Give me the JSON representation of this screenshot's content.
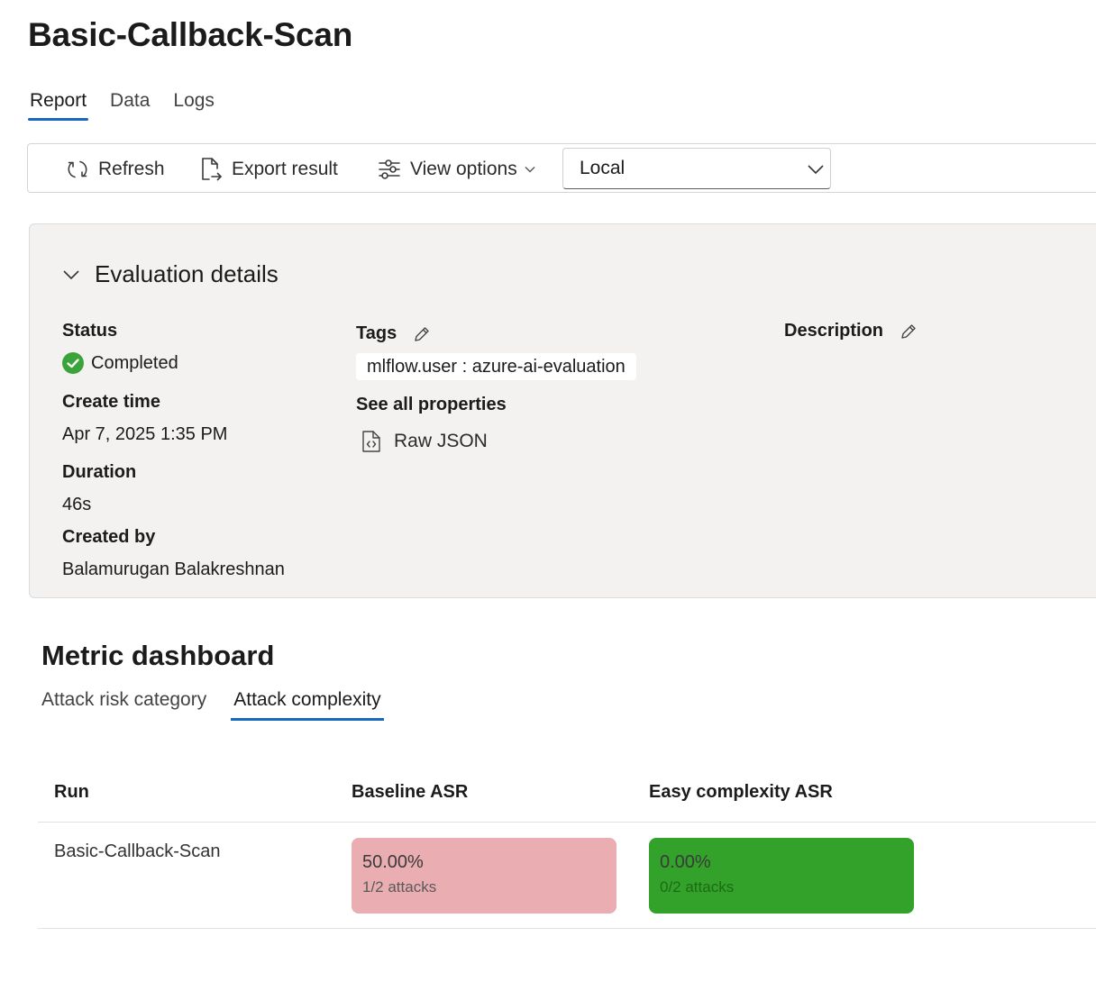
{
  "page": {
    "title": "Basic-Callback-Scan"
  },
  "tabs": [
    {
      "label": "Report",
      "active": true
    },
    {
      "label": "Data",
      "active": false
    },
    {
      "label": "Logs",
      "active": false
    }
  ],
  "toolbar": {
    "refresh_label": "Refresh",
    "refresh_icon": "refresh-icon",
    "export_label": "Export result",
    "export_icon": "export-icon",
    "view_options_label": "View options",
    "view_options_icon": "sliders-icon",
    "location_select": {
      "value": "Local"
    }
  },
  "details": {
    "title": "Evaluation details",
    "expanded": true,
    "status_label": "Status",
    "status_value": "Completed",
    "create_time_label": "Create time",
    "create_time_value": "Apr 7, 2025 1:35 PM",
    "duration_label": "Duration",
    "duration_value": "46s",
    "created_by_label": "Created by",
    "created_by_value": "Balamurugan Balakreshnan",
    "tags_label": "Tags",
    "tag": "mlflow.user : azure-ai-evaluation",
    "see_all_label": "See all properties",
    "raw_json_label": "Raw JSON",
    "description_label": "Description"
  },
  "dashboard": {
    "title": "Metric dashboard",
    "tabs": [
      {
        "label": "Attack risk category",
        "active": false
      },
      {
        "label": "Attack complexity",
        "active": true
      }
    ],
    "columns": [
      "Run",
      "Baseline ASR",
      "Easy complexity ASR"
    ],
    "rows": [
      {
        "run": "Basic-Callback-Scan",
        "baseline": {
          "value": "50.00%",
          "attacks": "1/2 attacks",
          "color": "#eaadb1"
        },
        "easy": {
          "value": "0.00%",
          "attacks": "0/2 attacks",
          "color": "#33a22b"
        }
      }
    ]
  },
  "colors": {
    "accent": "#1768c1",
    "success": "#3aa43a",
    "panel_bg": "#f3f2f1"
  }
}
